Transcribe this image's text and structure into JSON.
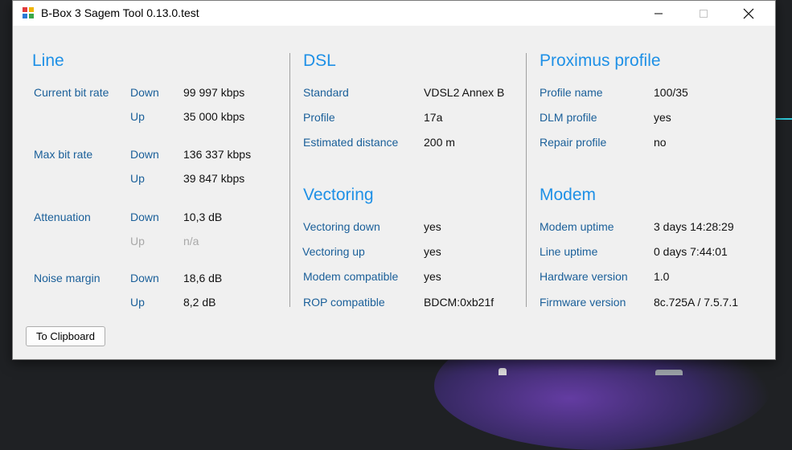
{
  "window": {
    "title": "B-Box 3 Sagem Tool 0.13.0.test"
  },
  "line": {
    "title": "Line",
    "current_bit_rate": {
      "label": "Current bit rate",
      "down_label": "Down",
      "down_value": "99 997 kbps",
      "up_label": "Up",
      "up_value": "35 000 kbps"
    },
    "max_bit_rate": {
      "label": "Max bit rate",
      "down_label": "Down",
      "down_value": "136 337 kbps",
      "up_label": "Up",
      "up_value": "39 847 kbps"
    },
    "attenuation": {
      "label": "Attenuation",
      "down_label": "Down",
      "down_value": "10,3 dB",
      "up_label": "Up",
      "up_value": "n/a"
    },
    "noise_margin": {
      "label": "Noise margin",
      "down_label": "Down",
      "down_value": "18,6 dB",
      "up_label": "Up",
      "up_value": "8,2 dB"
    }
  },
  "dsl": {
    "title": "DSL",
    "rows": [
      {
        "label": "Standard",
        "value": "VDSL2 Annex B"
      },
      {
        "label": "Profile",
        "value": "17a"
      },
      {
        "label": "Estimated distance",
        "value": "200 m"
      }
    ]
  },
  "vectoring": {
    "title": "Vectoring",
    "rows": [
      {
        "label": "Vectoring down",
        "value": "yes"
      },
      {
        "label": "Vectoring up",
        "value": "yes"
      },
      {
        "label": "Modem compatible",
        "value": "yes"
      },
      {
        "label": "ROP compatible",
        "value": "BDCM:0xb21f"
      }
    ]
  },
  "proximus": {
    "title": "Proximus profile",
    "rows": [
      {
        "label": "Profile name",
        "value": "100/35"
      },
      {
        "label": "DLM profile",
        "value": "yes"
      },
      {
        "label": "Repair profile",
        "value": "no"
      }
    ]
  },
  "modem": {
    "title": "Modem",
    "rows": [
      {
        "label": "Modem uptime",
        "value": "3 days 14:28:29"
      },
      {
        "label": "Line uptime",
        "value": "0 days 7:44:01"
      },
      {
        "label": "Hardware version",
        "value": "1.0"
      },
      {
        "label": "Firmware version",
        "value": "8c.725A / 7.5.7.1"
      }
    ]
  },
  "buttons": {
    "clipboard": "To Clipboard"
  },
  "colors": {
    "section_title": "#1e90e6",
    "label": "#1a5f99",
    "value": "#111111",
    "disabled": "#a8a8a8"
  },
  "icons": [
    "app-icon",
    "minimize-icon",
    "maximize-icon",
    "close-icon"
  ]
}
